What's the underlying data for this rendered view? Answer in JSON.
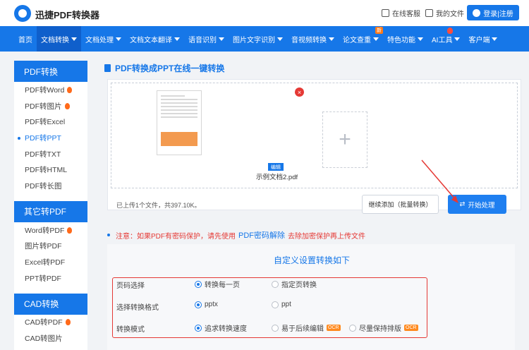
{
  "header": {
    "logo_text": "迅捷PDF转换器",
    "service": "在线客服",
    "my_files": "我的文件",
    "login": "登录|注册"
  },
  "nav": [
    "首页",
    "文档转换",
    "文档处理",
    "文档文本翻译",
    "语音识别",
    "图片文字识别",
    "音视频转换",
    "论文查重",
    "特色功能",
    "AI工具",
    "客户端"
  ],
  "nav_badge_new": "新",
  "sidebar": {
    "groups": [
      {
        "head": "PDF转换",
        "items": [
          "PDF转Word",
          "PDF转图片",
          "PDF转Excel",
          "PDF转PPT",
          "PDF转TXT",
          "PDF转HTML",
          "PDF转长图"
        ]
      },
      {
        "head": "其它转PDF",
        "items": [
          "Word转PDF",
          "图片转PDF",
          "Excel转PDF",
          "PPT转PDF"
        ]
      },
      {
        "head": "CAD转换",
        "items": [
          "CAD转PDF",
          "CAD转图片"
        ]
      }
    ]
  },
  "main": {
    "title": "PDF转换成PPT在线一键转换",
    "file_edit": "编辑",
    "file_name": "示例文档2.pdf",
    "upload_info": "已上传1个文件，共397.10K。",
    "continue_add": "继续添加（批量转换）",
    "start": "开始处理",
    "notice_a": "注意：如果PDF有密码保护，请先使用",
    "notice_link": "PDF密码解除",
    "notice_b": "去除加密保护再上传文件"
  },
  "settings": {
    "title": "自定义设置转换如下",
    "rows": [
      {
        "label": "页码选择",
        "opts": [
          "转换每一页",
          "指定页转换"
        ]
      },
      {
        "label": "选择转换格式",
        "opts": [
          "pptx",
          "ppt"
        ]
      },
      {
        "label": "转换模式",
        "opts": [
          "追求转换速度",
          "易于后续编辑",
          "尽量保持排版"
        ]
      }
    ],
    "ocr": "OCR"
  }
}
